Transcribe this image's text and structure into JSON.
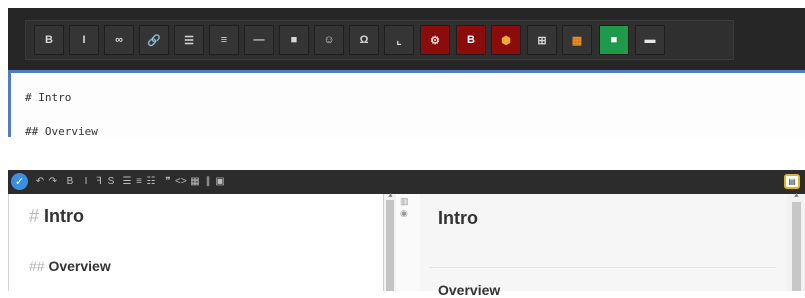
{
  "top_editor": {
    "toolbar_buttons": [
      {
        "name": "bold-button",
        "icon": "bold-icon",
        "glyph": "B",
        "bg": "#353535",
        "fg": "#d7d7d7"
      },
      {
        "name": "italic-button",
        "icon": "italic-icon",
        "glyph": "I",
        "bg": "#353535",
        "fg": "#d7d7d7"
      },
      {
        "name": "code-button",
        "icon": "infinity-icon",
        "glyph": "∞",
        "bg": "#353535",
        "fg": "#d7d7d7"
      },
      {
        "name": "link-button",
        "icon": "link-icon",
        "glyph": "🔗",
        "bg": "#353535",
        "fg": "#d7d7d7"
      },
      {
        "name": "bulleted-list-button",
        "icon": "list-icon",
        "glyph": "☰",
        "bg": "#353535",
        "fg": "#d7d7d7"
      },
      {
        "name": "numbered-list-button",
        "icon": "list-ordered-icon",
        "glyph": "≡",
        "bg": "#353535",
        "fg": "#d7d7d7"
      },
      {
        "name": "horizontal-rule-button",
        "icon": "minus-icon",
        "glyph": "—",
        "bg": "#353535",
        "fg": "#d7d7d7"
      },
      {
        "name": "image-button",
        "icon": "image-icon",
        "glyph": "■",
        "bg": "#353535",
        "fg": "#d7d7d7"
      },
      {
        "name": "emoji-button",
        "icon": "smiley-icon",
        "glyph": "☺",
        "bg": "#353535",
        "fg": "#d7d7d7"
      },
      {
        "name": "special-char-button",
        "icon": "omega-icon",
        "glyph": "Ω",
        "bg": "#353535",
        "fg": "#d7d7d7"
      },
      {
        "name": "subscript-button",
        "icon": "subscript-icon",
        "glyph": "⌞",
        "bg": "#353535",
        "fg": "#d7d7d7"
      },
      {
        "name": "plugin-gear-button",
        "icon": "gears-icon",
        "glyph": "⚙",
        "bg": "#8b0c0c",
        "fg": "#f2d7d7"
      },
      {
        "name": "plugin-b-button",
        "icon": "b-badge-icon",
        "glyph": "B",
        "bg": "#8b0c0c",
        "fg": "#ffffff"
      },
      {
        "name": "plugin-cube-button",
        "icon": "cube-icon",
        "glyph": "⬢",
        "bg": "#8b0c0c",
        "fg": "#f2a93b"
      },
      {
        "name": "table-button",
        "icon": "table-icon",
        "glyph": "⊞",
        "bg": "#353535",
        "fg": "#d7d7d7"
      },
      {
        "name": "plugin-orange-button",
        "icon": "orange-badge-icon",
        "glyph": "▦",
        "bg": "#353535",
        "fg": "#f28b21"
      },
      {
        "name": "plugin-green-button",
        "icon": "green-badge-icon",
        "glyph": "■",
        "bg": "#1f9a4b",
        "fg": "#ffffff"
      },
      {
        "name": "plugin-white-button",
        "icon": "box-icon",
        "glyph": "▬",
        "bg": "#353535",
        "fg": "#e6e6e6"
      }
    ],
    "lines": [
      "# Intro",
      "## Overview"
    ]
  },
  "bottom_editor": {
    "toolbar_buttons": [
      {
        "name": "undo-button",
        "icon": "undo-icon",
        "glyph": "↶"
      },
      {
        "name": "redo-button",
        "icon": "redo-icon",
        "glyph": "↷"
      },
      {
        "name": "bold-button",
        "icon": "bold-icon",
        "glyph": "B"
      },
      {
        "name": "italic-button",
        "icon": "italic-icon",
        "glyph": "I"
      },
      {
        "name": "heading-button",
        "icon": "heading-icon",
        "glyph": "ꟻ"
      },
      {
        "name": "strikethrough-button",
        "icon": "strike-icon",
        "glyph": "S"
      },
      {
        "name": "unordered-list-button",
        "icon": "list-icon",
        "glyph": "☰"
      },
      {
        "name": "ordered-list-button",
        "icon": "list-ordered-icon",
        "glyph": "≡"
      },
      {
        "name": "checklist-button",
        "icon": "checklist-icon",
        "glyph": "☷"
      },
      {
        "name": "quote-button",
        "icon": "quote-icon",
        "glyph": "❞"
      },
      {
        "name": "code-button",
        "icon": "code-icon",
        "glyph": "<>"
      },
      {
        "name": "table-button",
        "icon": "table-icon",
        "glyph": "▦"
      },
      {
        "name": "link-button",
        "icon": "link-icon",
        "glyph": "∥"
      },
      {
        "name": "image-button",
        "icon": "image-icon",
        "glyph": "▣"
      }
    ],
    "left_h1_hash": "#",
    "left_h1": "Intro",
    "left_h2_hash": "##",
    "left_h2": "Overview",
    "preview_h1": "Intro",
    "preview_h2": "Overview"
  }
}
